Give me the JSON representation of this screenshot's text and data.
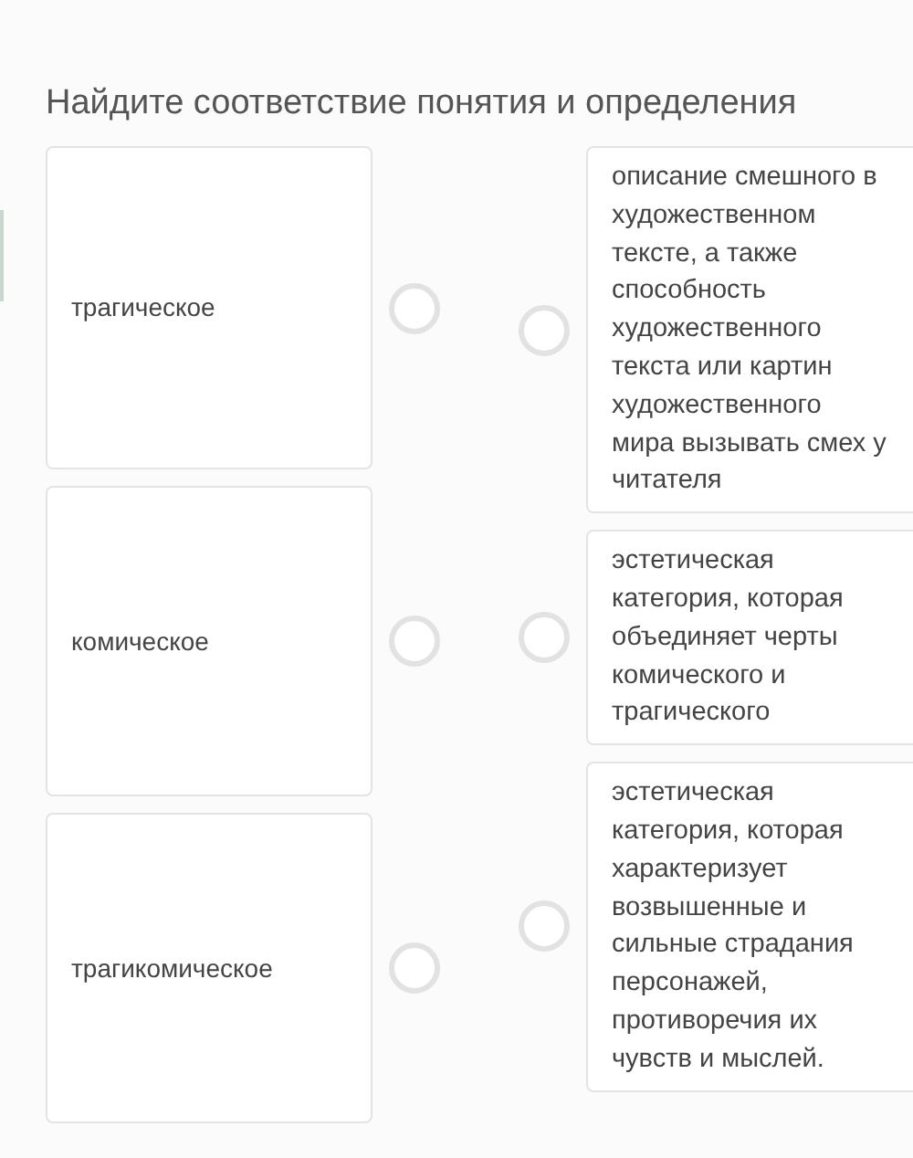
{
  "title": "Найдите соответствие понятия и определения",
  "terms": [
    {
      "text": "трагическое",
      "selected": false
    },
    {
      "text": "комическое",
      "selected": false
    },
    {
      "text": "трагикомическое",
      "selected": false
    }
  ],
  "definitions": [
    {
      "text": "описание смешного в художественном тексте, а также способность художественного текста или картин художественного мира вызывать смех у читателя",
      "selected": false
    },
    {
      "text": "эстетическая категория, которая объединяет черты комического и трагического",
      "selected": false
    },
    {
      "text": "эстетическая категория, которая характеризует возвышенные и сильные страдания персонажей, противоречия их чувств и мыслей.",
      "selected": false
    }
  ]
}
